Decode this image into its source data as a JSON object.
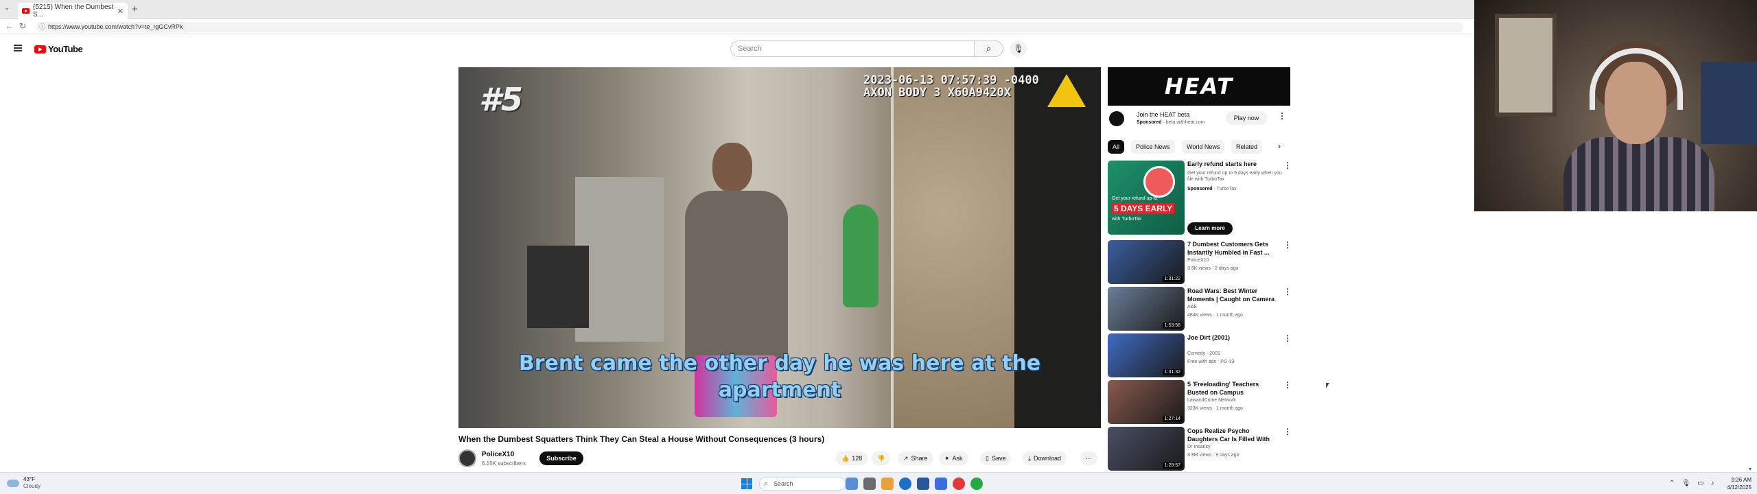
{
  "browser": {
    "tab_title": "(5215) When the Dumbest S...",
    "tab_close": "✕",
    "new_tab": "+",
    "url": "https://www.youtube.com/watch?v=te_rgGCvRPk"
  },
  "header": {
    "logo_text": "YouTube",
    "search_placeholder": "Search"
  },
  "video": {
    "rank_overlay": "#5",
    "timestamp_line1": "2023-06-13 07:57:39 -0400",
    "timestamp_line2": "AXON BODY 3 X60A9420X",
    "caption": "Brent came the other day he was here at the apartment",
    "title": "When the Dumbest Squatters Think They Can Steal a House Without Consequences (3 hours)",
    "channel_name": "PoliceX10",
    "channel_subs": "6.15K subscribers",
    "subscribe_label": "Subscribe",
    "actions": {
      "likes": "128",
      "share": "Share",
      "ask": "Ask",
      "save": "Save",
      "download": "Download"
    }
  },
  "sidebar": {
    "ad_banner": "HEAT",
    "ad_title": "Join the HEAT beta",
    "ad_sponsored": "Sponsored",
    "ad_domain": "beta.withheat.com",
    "ad_button": "Play now",
    "chips": [
      "All",
      "Police News",
      "World News",
      "Related"
    ],
    "ad_card": {
      "title": "Early refund starts here",
      "desc": "Get your refund up to 5 days early when you file with TurboTax",
      "sponsored": "Sponsored",
      "advertiser": "TurboTax",
      "thumb_line1": "Get your refund up to",
      "thumb_line2": "5 DAYS EARLY",
      "thumb_line3": "with TurboTax",
      "button": "Learn more"
    },
    "recommendations": [
      {
        "title": "7 Dumbest Customers Gets Instantly Humbled in Fast ...",
        "channel": "PoliceX10",
        "meta": "3.9K views · 2 days ago",
        "duration": "1:31:22",
        "thumb_color": "#3a5fa0"
      },
      {
        "title": "Road Wars: Best Winter Moments | Caught on Camera ...",
        "channel": "A&E",
        "meta": "484K views · 1 month ago",
        "duration": "1:53:58",
        "thumb_color": "#6b7f99"
      },
      {
        "title": "Joe Dirt (2001)",
        "channel": "Comedy · 2001",
        "meta": "Free with ads · PG-13",
        "duration": "1:31:32",
        "thumb_color": "#3f6cc4"
      },
      {
        "title": "5 'Freeloading' Teachers Busted on Campus",
        "channel": "LawandCrime Network",
        "meta": "323K views · 1 month ago",
        "duration": "1:27:14",
        "thumb_color": "#8a5a50"
      },
      {
        "title": "Cops Realize Psycho Daughters Car Is Filled With Bodies",
        "channel": "Dr Insanity",
        "meta": "3.9M views · 9 days ago",
        "duration": "1:29:57",
        "thumb_color": "#4a4f66"
      }
    ]
  },
  "taskbar": {
    "weather_temp": "43°F",
    "weather_desc": "Cloudy",
    "search_label": "Search",
    "time": "9:26 AM",
    "date": "4/12/2025"
  }
}
